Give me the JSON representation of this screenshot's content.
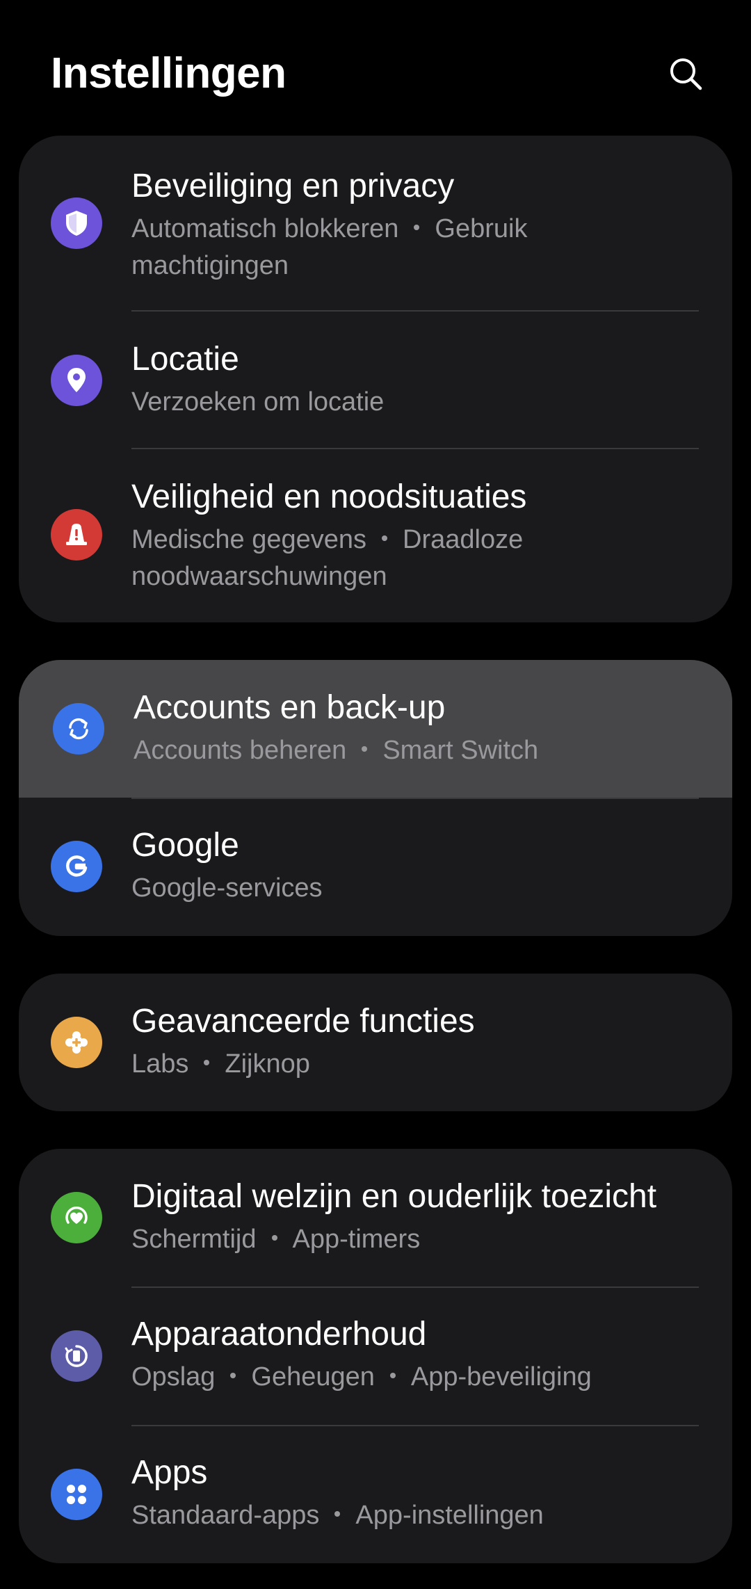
{
  "header": {
    "title": "Instellingen",
    "search_icon": "search-icon"
  },
  "colors": {
    "background": "#000000",
    "card": "#1a1a1c",
    "highlight": "#474749",
    "subtitle": "#9a9a9e",
    "security": "#6d53d9",
    "location": "#6d53d9",
    "safety": "#d33a36",
    "accounts": "#3a72e8",
    "google": "#3a72e8",
    "advanced": "#e9a84a",
    "wellbeing": "#4caf3c",
    "device_care": "#5d5ca8",
    "apps": "#3a72e8"
  },
  "cards": [
    {
      "items": [
        {
          "title": "Beveiliging en privacy",
          "subtitle": [
            "Automatisch blokkeren",
            "Gebruik",
            "machtigingen"
          ],
          "icon": "shield-icon"
        },
        {
          "title": "Locatie",
          "subtitle": [
            "Verzoeken om locatie"
          ],
          "icon": "location-pin-icon"
        },
        {
          "title": "Veiligheid en noodsituaties",
          "subtitle": [
            "Medische gegevens",
            "Draadloze",
            "noodwaarschuwingen"
          ],
          "icon": "emergency-icon"
        }
      ]
    },
    {
      "items": [
        {
          "title": "Accounts en back-up",
          "subtitle": [
            "Accounts beheren",
            "Smart Switch"
          ],
          "icon": "sync-icon"
        },
        {
          "title": "Google",
          "subtitle": [
            "Google-services"
          ],
          "icon": "google-icon"
        }
      ]
    },
    {
      "items": [
        {
          "title": "Geavanceerde functies",
          "subtitle": [
            "Labs",
            "Zijknop"
          ],
          "icon": "puzzle-icon"
        }
      ]
    },
    {
      "items": [
        {
          "title": "Digitaal welzijn en ouderlijk toezicht",
          "subtitle": [
            "Schermtijd",
            "App-timers"
          ],
          "icon": "heart-icon"
        },
        {
          "title": "Apparaatonderhoud",
          "subtitle": [
            "Opslag",
            "Geheugen",
            "App-beveiliging"
          ],
          "icon": "device-care-icon"
        },
        {
          "title": "Apps",
          "subtitle": [
            "Standaard-apps",
            "App-instellingen"
          ],
          "icon": "apps-grid-icon"
        }
      ]
    }
  ]
}
